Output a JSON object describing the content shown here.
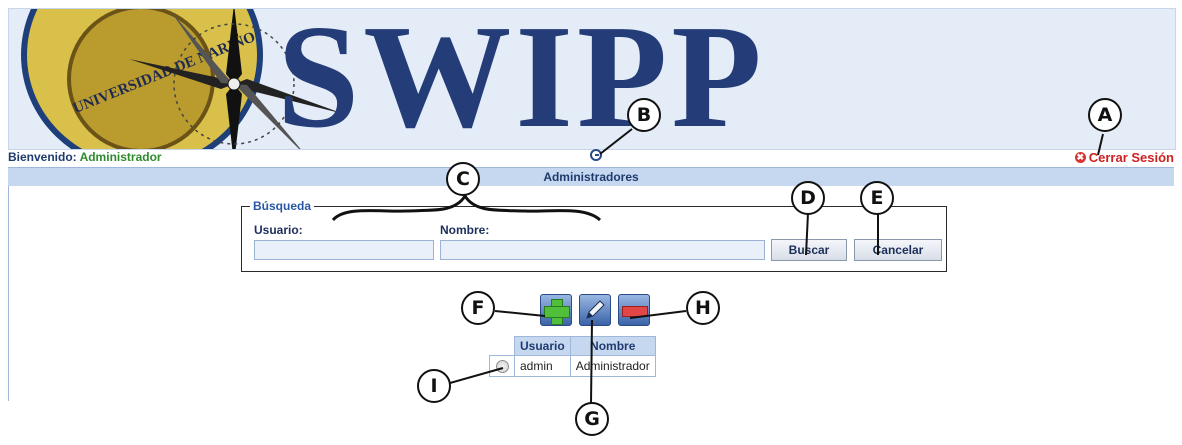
{
  "banner": {
    "title": "SWIPP",
    "seal_text": "UNIVERSIDAD DE NARIÑO"
  },
  "header": {
    "welcome_label": "Bienvenido:",
    "user_name": "Administrador",
    "logout_label": "Cerrar Sesión",
    "section_title": "Administradores"
  },
  "search": {
    "legend": "Búsqueda",
    "usuario_label": "Usuario:",
    "nombre_label": "Nombre:",
    "usuario_value": "",
    "nombre_value": "",
    "buscar_label": "Buscar",
    "cancelar_label": "Cancelar"
  },
  "toolbar": {
    "icons": [
      "add-icon",
      "edit-pencil-icon",
      "delete-icon"
    ]
  },
  "table": {
    "headers": [
      "Usuario",
      "Nombre"
    ],
    "rows": [
      {
        "usuario": "admin",
        "nombre": "Administrador"
      }
    ]
  },
  "callouts": {
    "A": "A",
    "B": "B",
    "C": "C",
    "D": "D",
    "E": "E",
    "F": "F",
    "G": "G",
    "H": "H",
    "I": "I"
  },
  "colors": {
    "banner_text": "#243d78",
    "header_bg": "#c6d8f0",
    "user_green": "#2e8b2e",
    "logout_red": "#cc2222"
  }
}
